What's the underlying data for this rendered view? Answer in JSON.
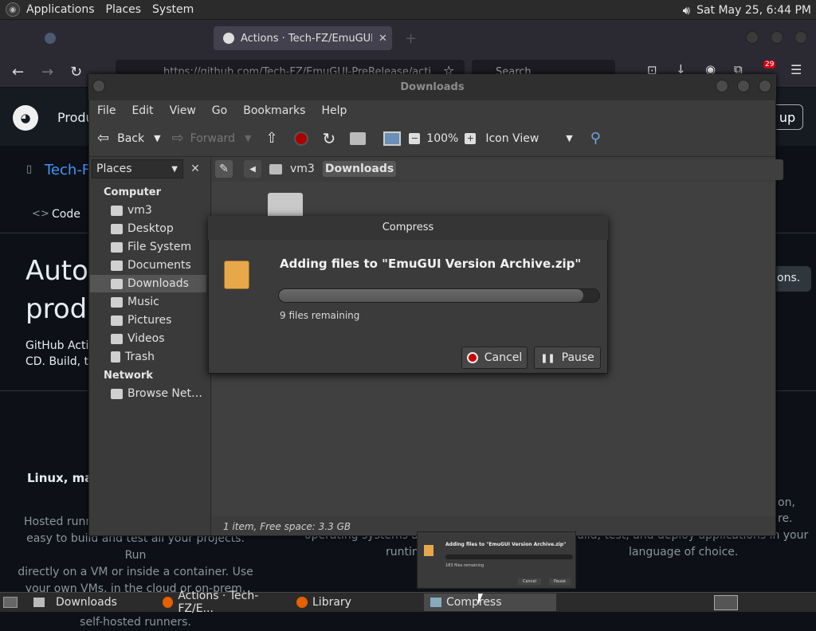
{
  "top_panel": {
    "menus": [
      "Applications",
      "Places",
      "System"
    ],
    "clock": "Sat May 25,  6:44 PM"
  },
  "firefox": {
    "active_tab_title": "Actions · Tech-FZ/EmuGUI-",
    "url": "https://github.com/Tech-FZ/EmuGUI-PreRelease/acti",
    "search_placeholder": "Search",
    "badge_count": "29"
  },
  "github": {
    "nav_product": "Produ",
    "repo_name": "Tech-F",
    "code_tab": "Code",
    "hero_line1": "Autor",
    "hero_line2": "produ",
    "hero_desc1": "GitHub Actio",
    "hero_desc2": "CD. Build, te",
    "signup": "up",
    "right_button": "ons.",
    "section_title": "Linux, ma",
    "para_left": [
      "Hosted runn",
      "easy to build and test all your projects. Run",
      "directly on a VM or inside a container. Use",
      "your own VMs, in the cloud or on-prem, with",
      "self-hosted runners."
    ],
    "para_mid": [
      "operating systems ar",
      "runtim"
    ],
    "para_right": [
      "uild, test, and deploy applications in your",
      "language of choice."
    ],
    "right_frag1": "on,",
    "right_frag2": "re."
  },
  "file_manager": {
    "title": "Downloads",
    "menu": [
      "File",
      "Edit",
      "View",
      "Go",
      "Bookmarks",
      "Help"
    ],
    "toolbar": {
      "back": "Back",
      "forward": "Forward",
      "zoom": "100%",
      "view_mode": "Icon View"
    },
    "places_label": "Places",
    "sidebar": {
      "computer_header": "Computer",
      "computer_items": [
        "vm3",
        "Desktop",
        "File System",
        "Documents",
        "Downloads",
        "Music",
        "Pictures",
        "Videos",
        "Trash"
      ],
      "network_header": "Network",
      "network_items": [
        "Browse Net…"
      ]
    },
    "path": [
      "vm3",
      "Downloads"
    ],
    "status": "1 item, Free space: 3.3 GB"
  },
  "dialog": {
    "title": "Compress",
    "message": "Adding files to \"EmuGUI Version Archive.zip\"",
    "remaining": "9 files remaining",
    "progress": 0.95,
    "cancel": "Cancel",
    "pause": "Pause"
  },
  "thumbnail": {
    "message": "Adding files to \"EmuGUI Version Archive.zip\"",
    "remaining": "183 files remaining",
    "cancel": "Cancel",
    "pause": "Pause"
  },
  "taskbar": {
    "tasks": [
      "Downloads",
      "Actions · Tech-FZ/E...",
      "Library",
      "Compress"
    ]
  }
}
